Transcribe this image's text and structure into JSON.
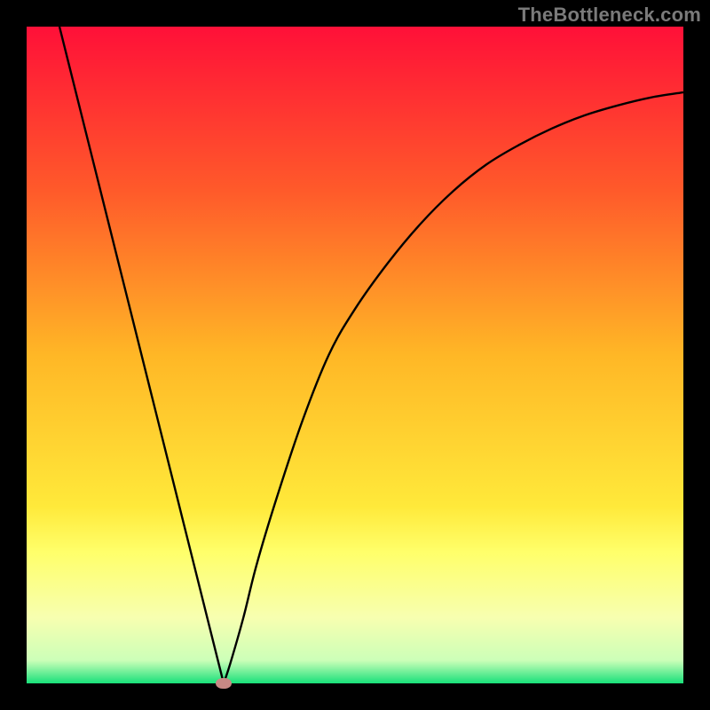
{
  "watermark": "TheBottleneck.com",
  "chart_data": {
    "type": "line",
    "title": "",
    "xlabel": "",
    "ylabel": "",
    "xlim": [
      0,
      100
    ],
    "ylim": [
      0,
      100
    ],
    "grid": false,
    "legend": false,
    "gradient_stops": [
      {
        "offset": 0.0,
        "color": "#ff1038"
      },
      {
        "offset": 0.25,
        "color": "#ff5a2a"
      },
      {
        "offset": 0.5,
        "color": "#ffb726"
      },
      {
        "offset": 0.73,
        "color": "#ffe93a"
      },
      {
        "offset": 0.8,
        "color": "#ffff6a"
      },
      {
        "offset": 0.9,
        "color": "#f7ffb0"
      },
      {
        "offset": 0.965,
        "color": "#ccffb8"
      },
      {
        "offset": 1.0,
        "color": "#18e07a"
      }
    ],
    "series": [
      {
        "name": "curve",
        "color": "#000000",
        "x": [
          5,
          7,
          9,
          11,
          13,
          15,
          17,
          19,
          21,
          23,
          25,
          27,
          29,
          30,
          31,
          33,
          35,
          38,
          42,
          46,
          50,
          55,
          60,
          65,
          70,
          75,
          80,
          85,
          90,
          95,
          100
        ],
        "y": [
          100,
          92,
          84,
          76,
          68,
          60,
          52,
          44,
          36,
          28,
          20,
          12,
          4,
          0,
          3,
          10,
          18,
          28,
          40,
          50,
          57,
          64,
          70,
          75,
          79,
          82,
          84.5,
          86.5,
          88,
          89.2,
          90
        ]
      }
    ],
    "marker": {
      "name": "vertex-dot",
      "x": 30,
      "y": 0,
      "color": "#c88985"
    }
  }
}
